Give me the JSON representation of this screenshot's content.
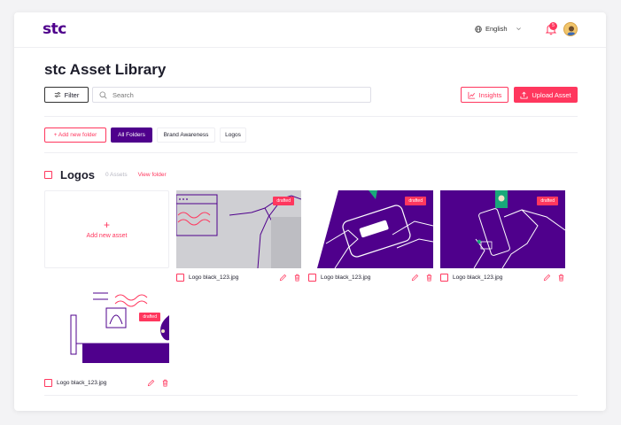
{
  "brand": {
    "logo": "stc",
    "accent": "#ff375e",
    "primary": "#4f008c"
  },
  "header": {
    "language": "English",
    "notifications": "5"
  },
  "page": {
    "title": "stc Asset Library"
  },
  "toolbar": {
    "filter_label": "Filter",
    "search_placeholder": "Search",
    "insights_label": "Insights",
    "upload_label": "Upload Asset"
  },
  "folders": {
    "add_label": "+ Add new folder",
    "items": [
      "All Folders",
      "Brand Awareness",
      "Logos"
    ],
    "active": "All Folders"
  },
  "section": {
    "title": "Logos",
    "count": "0 Assets",
    "link": "View folder",
    "add_asset_plus": "+",
    "add_asset_label": "Add new asset"
  },
  "assets": [
    {
      "name": "Logo black_123.jpg",
      "status": "drafted"
    },
    {
      "name": "Logo black_123.jpg",
      "status": "drafted"
    },
    {
      "name": "Logo black_123.jpg",
      "status": "drafted"
    },
    {
      "name": "Logo black_123.jpg",
      "status": "drafted"
    }
  ],
  "icons": {
    "filter": "sliders-icon",
    "search": "search-icon",
    "insights": "chart-icon",
    "upload": "upload-icon",
    "language": "globe-icon",
    "bell": "bell-icon",
    "edit": "pencil-icon",
    "delete": "trash-icon"
  }
}
